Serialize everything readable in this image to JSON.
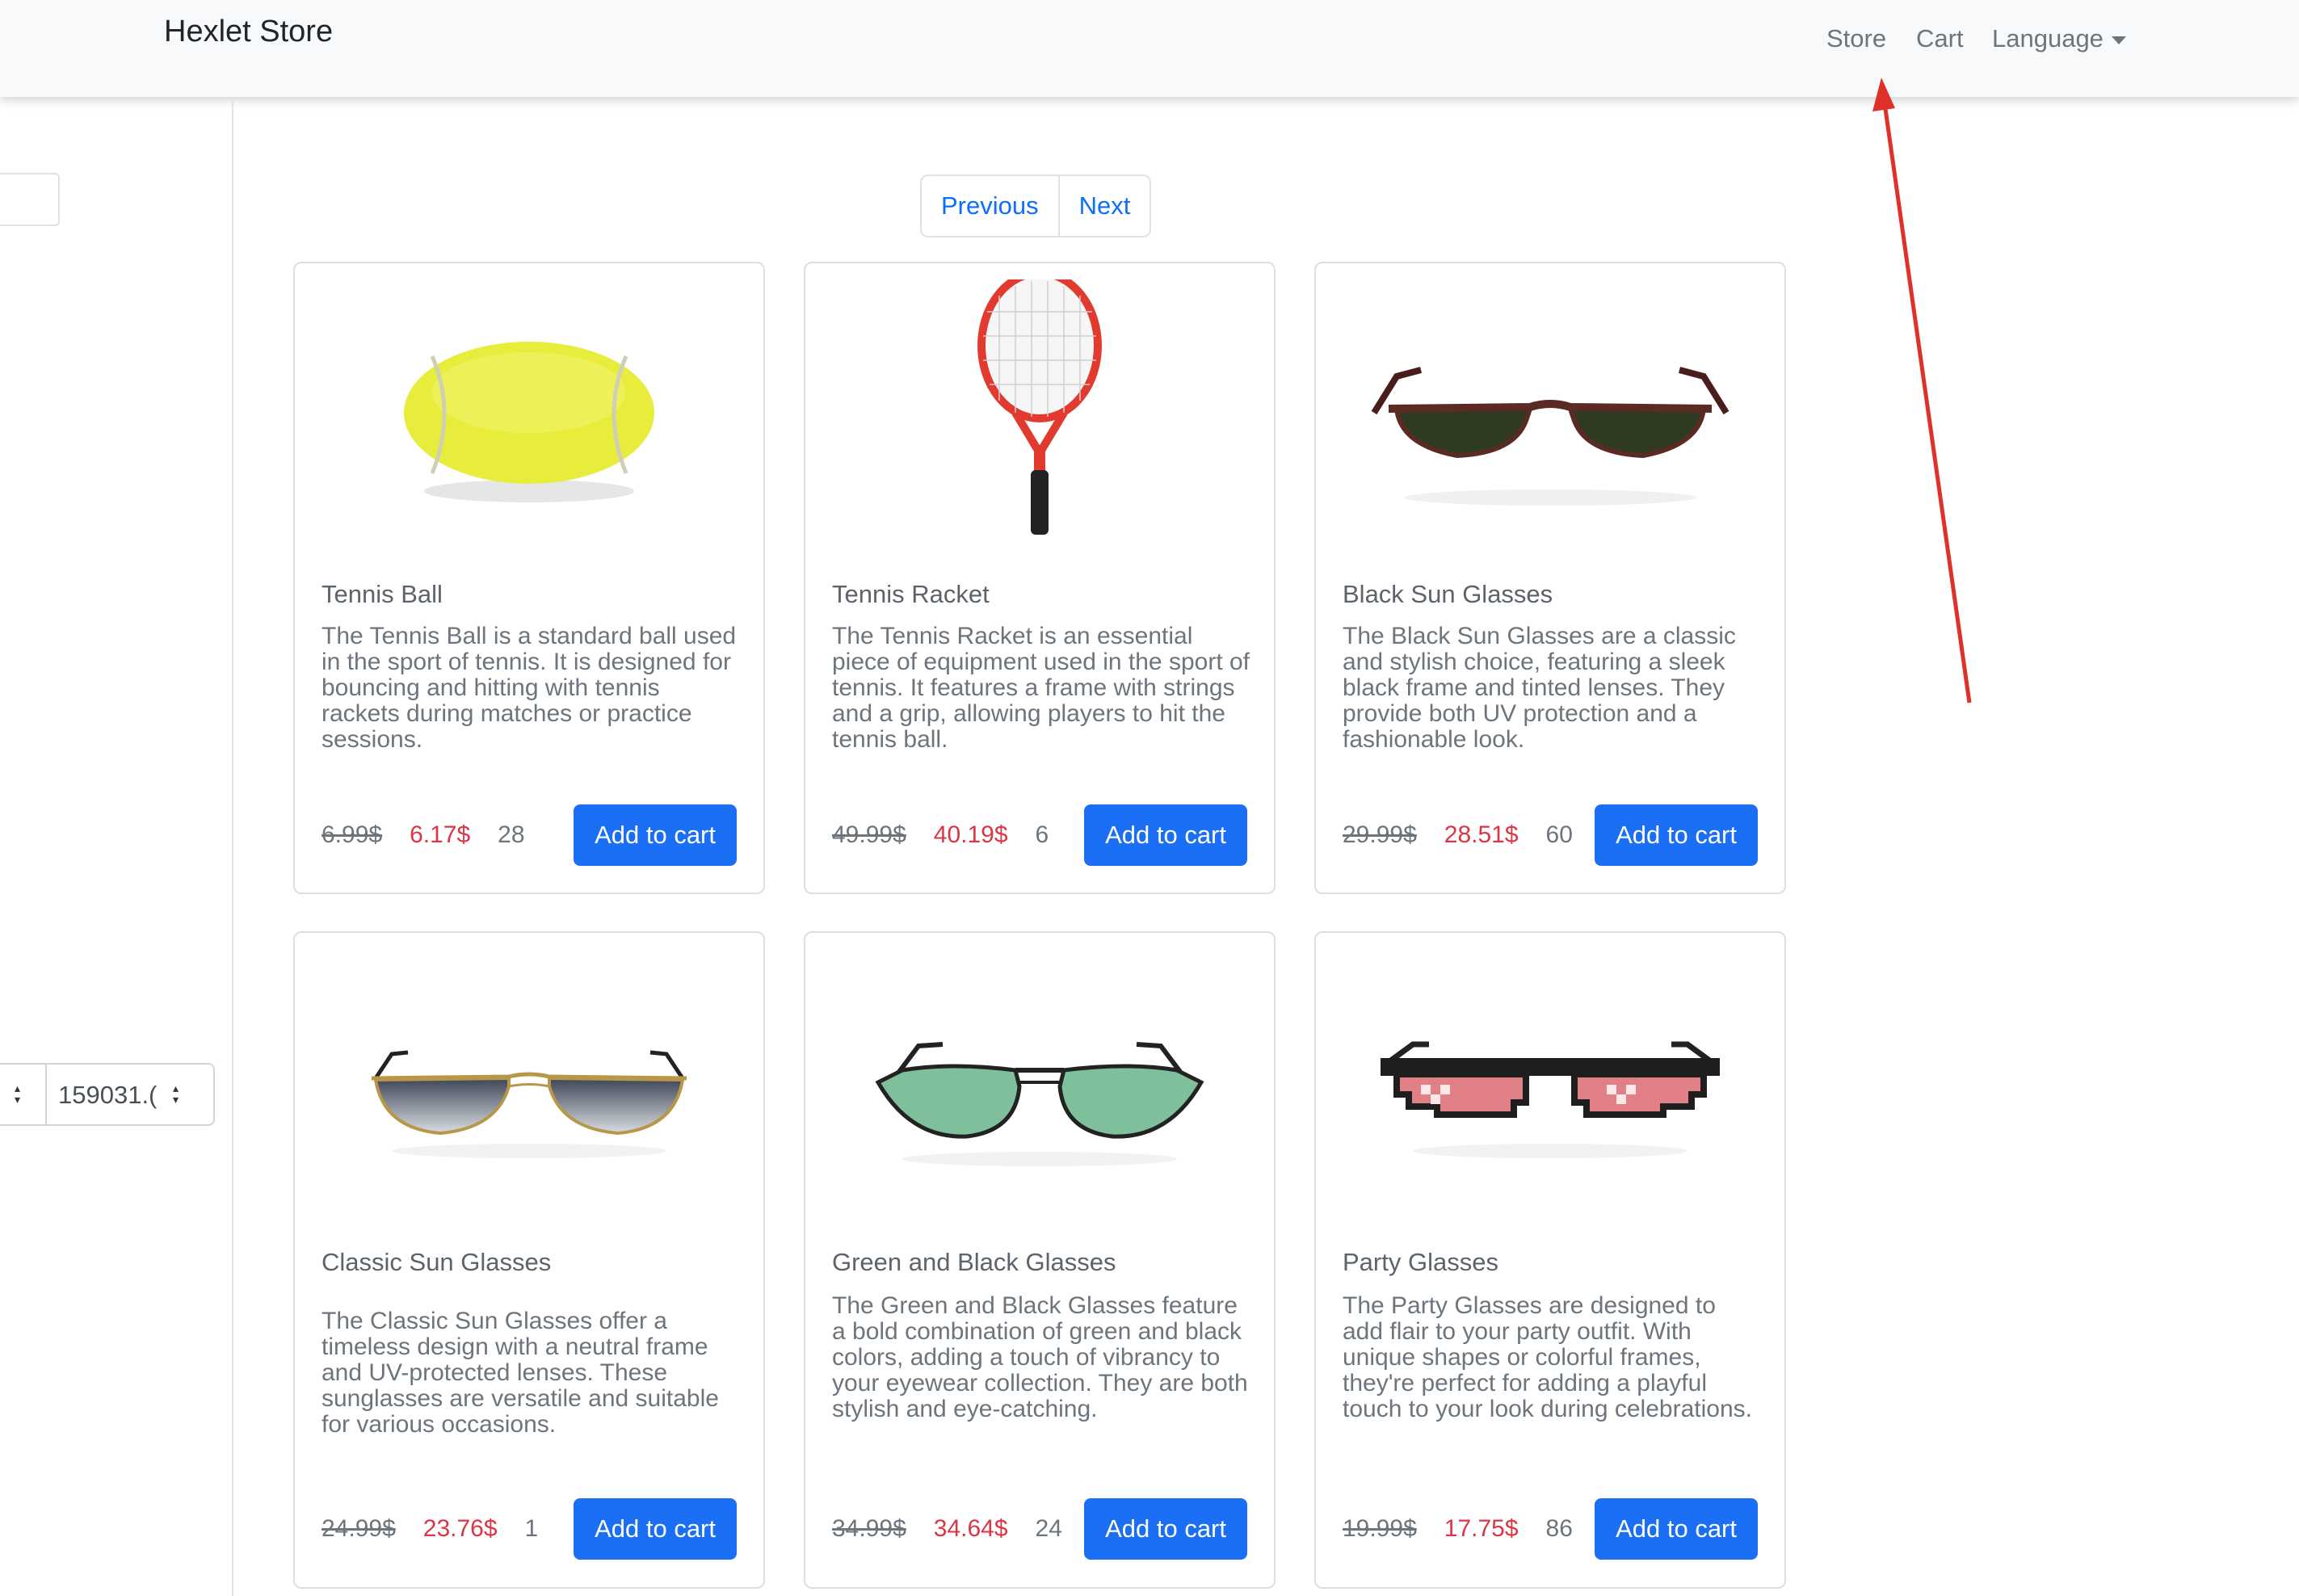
{
  "navbar": {
    "brand": "Hexlet Store",
    "links": [
      "Store",
      "Cart",
      "Language"
    ]
  },
  "sidebar": {
    "filter_value": "159031.("
  },
  "pagination": {
    "previous": "Previous",
    "next": "Next"
  },
  "products": [
    {
      "title": "Tennis Ball",
      "description": "The Tennis Ball is a standard ball used in the sport of tennis. It is designed for bouncing and hitting with tennis rackets during matches or practice sessions.",
      "old_price": "6.99$",
      "new_price": "6.17$",
      "stock": "28",
      "button": "Add to cart",
      "icon": "tennis-ball"
    },
    {
      "title": "Tennis Racket",
      "description": "The Tennis Racket is an essential piece of equipment used in the sport of tennis. It features a frame with strings and a grip, allowing players to hit the tennis ball.",
      "old_price": "49.99$",
      "new_price": "40.19$",
      "stock": "6",
      "button": "Add to cart",
      "icon": "tennis-racket"
    },
    {
      "title": "Black Sun Glasses",
      "description": "The Black Sun Glasses are a classic and stylish choice, featuring a sleek black frame and tinted lenses. They provide both UV protection and a fashionable look.",
      "old_price": "29.99$",
      "new_price": "28.51$",
      "stock": "60",
      "button": "Add to cart",
      "icon": "black-sunglasses"
    },
    {
      "title": "Classic Sun Glasses",
      "description": "The Classic Sun Glasses offer a timeless design with a neutral frame and UV-protected lenses. These sunglasses are versatile and suitable for various occasions.",
      "old_price": "24.99$",
      "new_price": "23.76$",
      "stock": "1",
      "button": "Add to cart",
      "icon": "aviator-sunglasses"
    },
    {
      "title": "Green and Black Glasses",
      "description": "The Green and Black Glasses feature a bold combination of green and black colors, adding a touch of vibrancy to your eyewear collection. They are both stylish and eye-catching.",
      "old_price": "34.99$",
      "new_price": "34.64$",
      "stock": "24",
      "button": "Add to cart",
      "icon": "green-glasses"
    },
    {
      "title": "Party Glasses",
      "description": "The Party Glasses are designed to add flair to your party outfit. With unique shapes or colorful frames, they're perfect for adding a playful touch to your look during celebrations.",
      "old_price": "19.99$",
      "new_price": "17.75$",
      "stock": "86",
      "button": "Add to cart",
      "icon": "pixel-party-glasses"
    }
  ],
  "colors": {
    "primary_button": "#1a6ff5",
    "sale_price": "#dc3545",
    "annotation_arrow": "#e0302a"
  }
}
